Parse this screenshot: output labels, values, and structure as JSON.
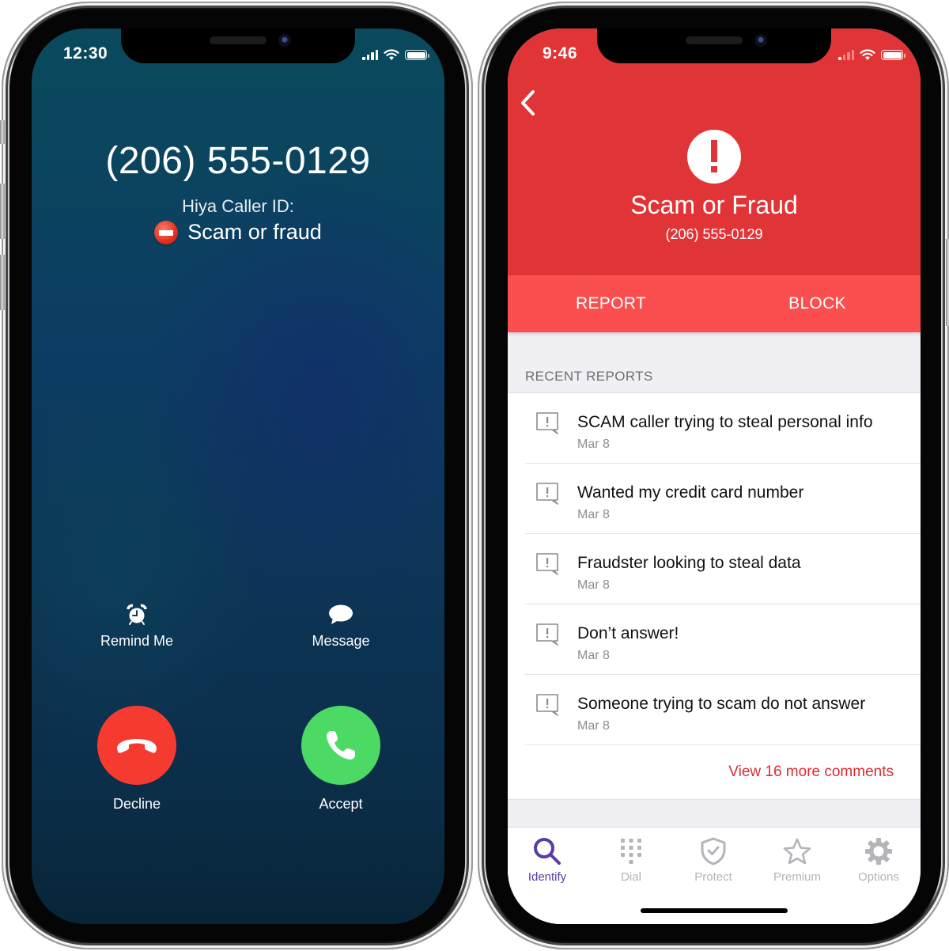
{
  "left_phone": {
    "status_bar": {
      "time": "12:30",
      "signal_bars": 4,
      "battery_percent": 100
    },
    "caller": {
      "number": "(206) 555-0129",
      "caller_id_label": "Hiya Caller ID:",
      "caller_id_value": "Scam or fraud",
      "caller_id_icon": "no-entry-icon"
    },
    "actions": {
      "remind": {
        "label": "Remind Me",
        "icon": "alarm-clock-icon"
      },
      "message": {
        "label": "Message",
        "icon": "speech-bubble-icon"
      }
    },
    "call_buttons": {
      "decline": {
        "label": "Decline",
        "icon": "phone-hangup-icon",
        "color": "#f53b30"
      },
      "accept": {
        "label": "Accept",
        "icon": "phone-icon",
        "color": "#4cd964"
      }
    }
  },
  "right_phone": {
    "status_bar": {
      "time": "9:46",
      "signal_bars": 1,
      "battery_percent": 100
    },
    "header": {
      "back_icon": "chevron-left-icon",
      "alert_icon": "exclamation-circle-icon",
      "title": "Scam or Fraud",
      "number": "(206) 555-0129",
      "color": "#e13437"
    },
    "action_bar": {
      "report_label": "REPORT",
      "block_label": "BLOCK",
      "color": "#fb4f4f"
    },
    "recent_reports": {
      "section_title": "RECENT REPORTS",
      "items": [
        {
          "text": "SCAM caller trying to steal personal info",
          "date": "Mar 8"
        },
        {
          "text": "Wanted my credit card number",
          "date": "Mar 8"
        },
        {
          "text": "Fraudster looking to steal data",
          "date": "Mar 8"
        },
        {
          "text": "Don’t answer!",
          "date": "Mar 8"
        },
        {
          "text": "Someone trying to scam do not answer",
          "date": "Mar 8"
        }
      ],
      "view_more": "View 16 more comments",
      "link_color": "#dc2b30"
    },
    "tabbar": {
      "active_color": "#5a3aa8",
      "inactive_color": "#b4b4ba",
      "tabs": [
        {
          "label": "Identify",
          "icon": "search-icon",
          "active": true
        },
        {
          "label": "Dial",
          "icon": "keypad-icon",
          "active": false
        },
        {
          "label": "Protect",
          "icon": "shield-check-icon",
          "active": false
        },
        {
          "label": "Premium",
          "icon": "star-icon",
          "active": false
        },
        {
          "label": "Options",
          "icon": "gear-icon",
          "active": false
        }
      ]
    }
  }
}
